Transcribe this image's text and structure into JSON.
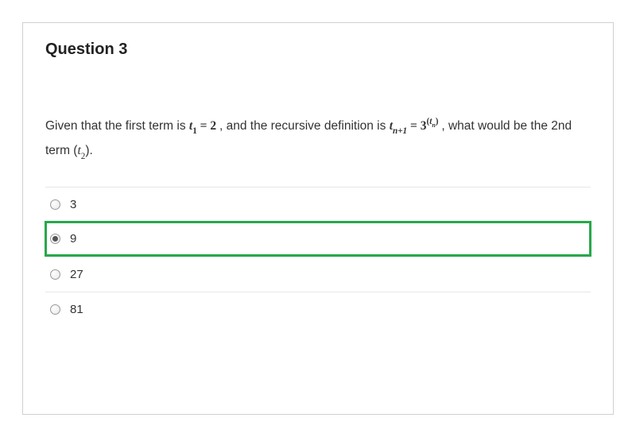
{
  "question": {
    "title": "Question 3",
    "prompt_pre": "Given that the first term is ",
    "math1": {
      "var": "t",
      "sub": "1",
      "eq": " = ",
      "val": "2"
    },
    "prompt_mid": ", and the recursive definition is ",
    "math2": {
      "lhs_var": "t",
      "lhs_sub": "n+1",
      "eq": " = ",
      "base": "3",
      "exp_open": "(",
      "exp_var": "t",
      "exp_sub": "n",
      "exp_close": ")"
    },
    "prompt_after": " , what would be the 2nd term (",
    "math3": {
      "var": "t",
      "sub": "2"
    },
    "prompt_end": ")."
  },
  "options": [
    {
      "label": "3",
      "selected": false
    },
    {
      "label": "9",
      "selected": true
    },
    {
      "label": "27",
      "selected": false
    },
    {
      "label": "81",
      "selected": false
    }
  ]
}
